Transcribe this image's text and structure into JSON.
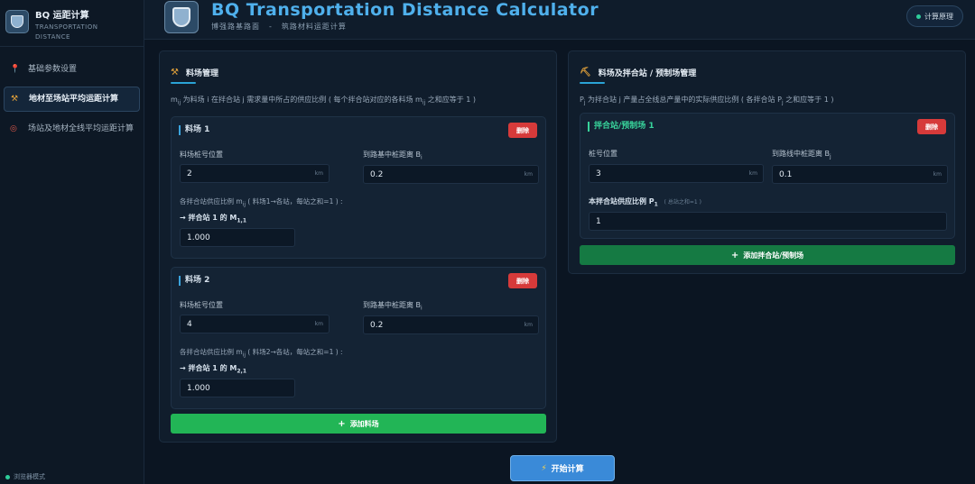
{
  "sidebar": {
    "brand_title": "BQ 运距计算",
    "brand_subtitle": "TRANSPORTATION DISTANCE",
    "items": [
      {
        "label": "基础参数设置",
        "icon": "pin-icon"
      },
      {
        "label": "地材至场站平均运距计算",
        "icon": "hammer-icon"
      },
      {
        "label": "场站及地材全线平均运距计算",
        "icon": "target-icon"
      }
    ],
    "mode_label": "浏览器模式"
  },
  "header": {
    "title": "BQ Transportation Distance Calculator",
    "subtitle_left": "博强路基路面",
    "subtitle_sep": "-",
    "subtitle_right": "筑路材料运距计算",
    "theory_button": "计算原理"
  },
  "left_panel": {
    "title": "料场管理",
    "desc_prefix": "m",
    "desc_sub": "ij",
    "desc_main": " 为料场 i 在拌合站 j 需求量中所占的供应比例 ( 每个拌合站对应的各料场 m",
    "desc_sub2": "ij",
    "desc_suffix": " 之和应等于 1 )",
    "cards": [
      {
        "title": "料场 1",
        "delete_label": "删除",
        "pos_label": "料场桩号位置",
        "pos_value": "2",
        "pos_unit": "km",
        "dist_label": "到路基中桩距离 B",
        "dist_sub": "i",
        "dist_value": "0.2",
        "dist_unit": "km",
        "ratio_desc": "各拌合站供应比例 m",
        "ratio_desc_sub": "ij",
        "ratio_desc_suffix": " ( 料场1→各站，每站之和=1 ) :",
        "ratio_label": "→ 拌合站 1 的 M",
        "ratio_label_sub": "1,1",
        "ratio_value": "1.000"
      },
      {
        "title": "料场 2",
        "delete_label": "删除",
        "pos_label": "料场桩号位置",
        "pos_value": "4",
        "pos_unit": "km",
        "dist_label": "到路基中桩距离 B",
        "dist_sub": "i",
        "dist_value": "0.2",
        "dist_unit": "km",
        "ratio_desc": "各拌合站供应比例 m",
        "ratio_desc_sub": "ij",
        "ratio_desc_suffix": " ( 料场2→各站，每站之和=1 ) :",
        "ratio_label": "→ 拌合站 1 的 M",
        "ratio_label_sub": "2,1",
        "ratio_value": "1.000"
      }
    ],
    "add_button": "添加料场"
  },
  "right_panel": {
    "title": "料场及拌合站 / 预制场管理",
    "desc_prefix": "P",
    "desc_sub": "j",
    "desc_main": " 为拌合站 j 产量占全线总产量中的实际供应比例 ( 各拌合站 P",
    "desc_sub2": "j",
    "desc_suffix": " 之和应等于 1 )",
    "card": {
      "title": "拌合站/预制场 1",
      "delete_label": "删除",
      "pos_label": "桩号位置",
      "pos_value": "3",
      "pos_unit": "km",
      "dist_label": "到路线中桩距离 B",
      "dist_sub": "j",
      "dist_value": "0.1",
      "dist_unit": "km",
      "ratio_label": "本拌合站供应比例 P",
      "ratio_sub": "1",
      "ratio_hint": "( 总站之和=1 )",
      "ratio_value": "1"
    },
    "add_button": "添加拌合站/预制场"
  },
  "calc_button": "开始计算",
  "colors": {
    "accent_blue": "#4fb0ec",
    "green": "#22b556",
    "delete_red": "#d63a3a"
  }
}
